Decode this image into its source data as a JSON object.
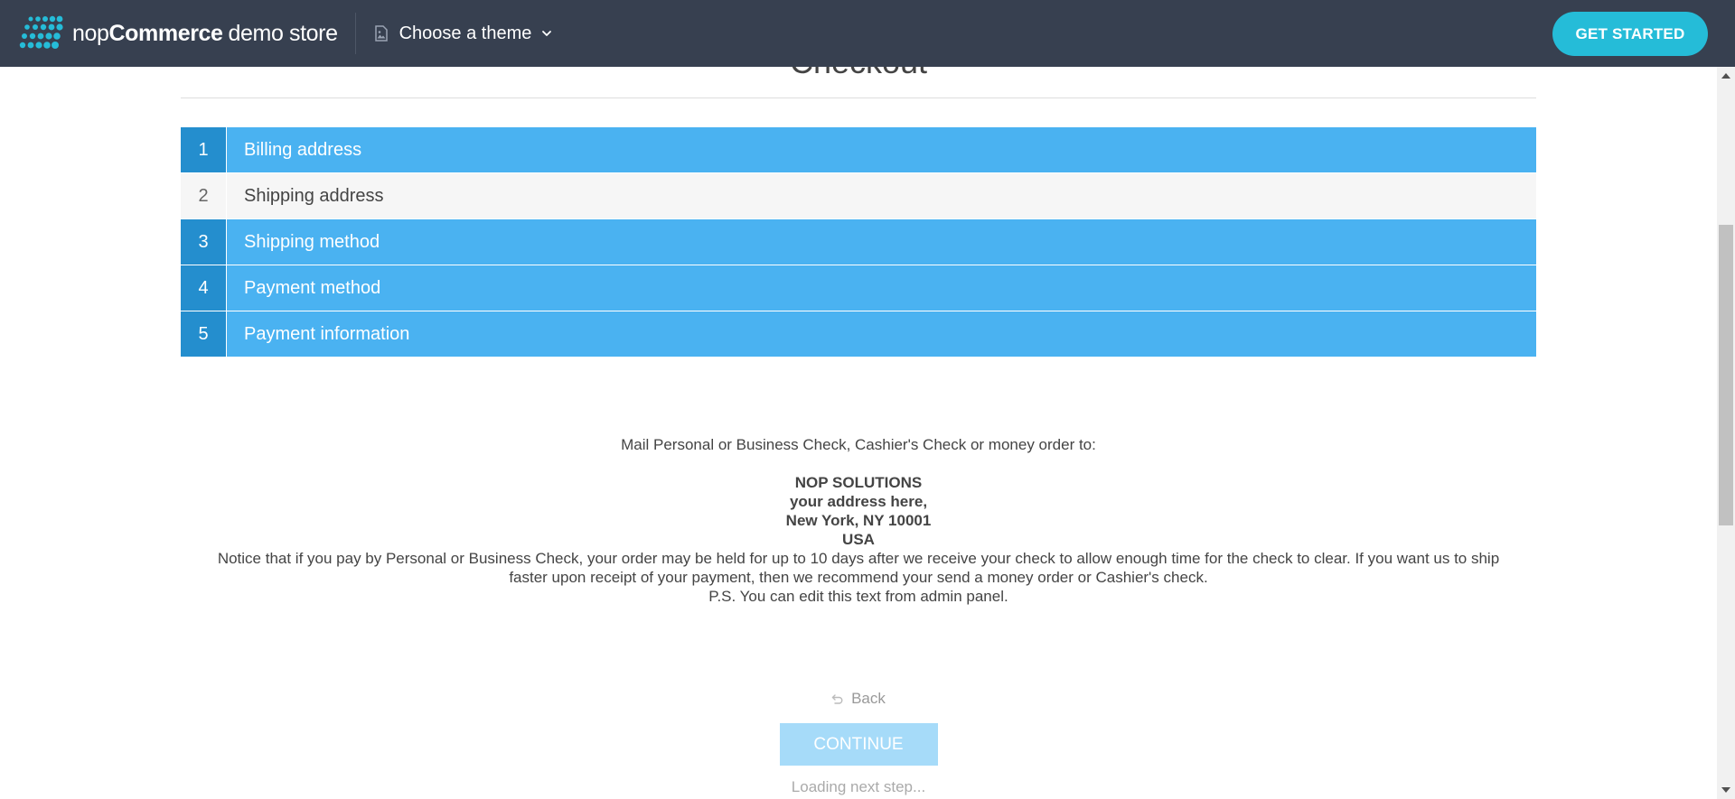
{
  "topbar": {
    "brand_nop": "nop",
    "brand_commerce": "Commerce",
    "brand_demo": "demo store",
    "theme_chooser_label": "Choose a theme",
    "get_started_label": "GET STARTED",
    "colors": {
      "bar": "#374050",
      "accent": "#25bcd8"
    }
  },
  "page": {
    "title": "Checkout"
  },
  "checkout_steps": [
    {
      "number": "1",
      "label": "Billing address",
      "state": "completed"
    },
    {
      "number": "2",
      "label": "Shipping address",
      "state": "inactive"
    },
    {
      "number": "3",
      "label": "Shipping method",
      "state": "completed"
    },
    {
      "number": "4",
      "label": "Payment method",
      "state": "completed"
    },
    {
      "number": "5",
      "label": "Payment information",
      "state": "current"
    }
  ],
  "payment_info": {
    "intro": "Mail Personal or Business Check, Cashier's Check or money order to:",
    "address_lines": [
      "NOP SOLUTIONS",
      "your address here,",
      "New York, NY 10001",
      "USA"
    ],
    "notice": "Notice that if you pay by Personal or Business Check, your order may be held for up to 10 days after we receive your check to allow enough time for the check to clear. If you want us to ship faster upon receipt of your payment, then we recommend your send a money order or Cashier's check.",
    "ps": "P.S. You can edit this text from admin panel."
  },
  "actions": {
    "back_label": "Back",
    "continue_label": "CONTINUE",
    "loading_label": "Loading next step..."
  },
  "icons": {
    "theme": "image-icon",
    "chevron": "chevron-down-icon",
    "back": "undo-arrow-icon"
  },
  "colors": {
    "step_active": "#4ab2f1",
    "step_number_active": "#248ece",
    "step_inactive": "#f6f6f6",
    "continue_disabled": "#a6dbf9"
  }
}
